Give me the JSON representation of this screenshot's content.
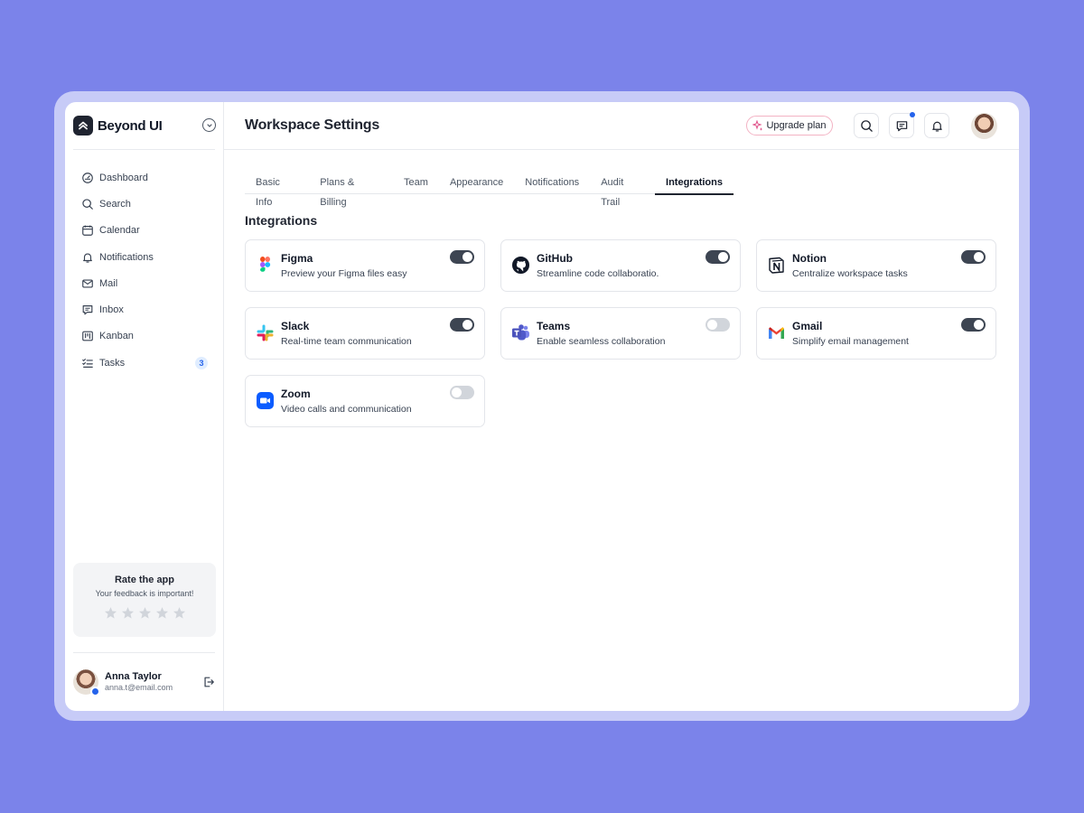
{
  "brand": {
    "name": "Beyond UI"
  },
  "sidebar": {
    "items": [
      {
        "label": "Dashboard",
        "icon": "dashboard-icon"
      },
      {
        "label": "Search",
        "icon": "search-icon"
      },
      {
        "label": "Calendar",
        "icon": "calendar-icon"
      },
      {
        "label": "Notifications",
        "icon": "bell-icon"
      },
      {
        "label": "Mail",
        "icon": "mail-icon"
      },
      {
        "label": "Inbox",
        "icon": "inbox-icon"
      },
      {
        "label": "Kanban",
        "icon": "kanban-icon"
      },
      {
        "label": "Tasks",
        "icon": "tasks-icon",
        "badge": "3"
      }
    ],
    "rate": {
      "title": "Rate the app",
      "subtitle": "Your feedback is important!",
      "stars_filled": 0,
      "stars_total": 5
    },
    "user": {
      "name": "Anna Taylor",
      "email": "anna.t@email.com"
    }
  },
  "header": {
    "title": "Workspace Settings",
    "upgrade_label": "Upgrade plan",
    "has_unread_messages": true
  },
  "tabs": [
    {
      "label": "Basic Info",
      "active": false
    },
    {
      "label": "Plans & Billing",
      "active": false
    },
    {
      "label": "Team",
      "active": false
    },
    {
      "label": "Appearance",
      "active": false
    },
    {
      "label": "Notifications",
      "active": false
    },
    {
      "label": "Audit Trail",
      "active": false
    },
    {
      "label": "Integrations",
      "active": true
    }
  ],
  "integrations": {
    "title": "Integrations",
    "items": [
      {
        "name": "Figma",
        "description": "Preview your Figma files easy",
        "enabled": true,
        "icon": "figma-icon"
      },
      {
        "name": "GitHub",
        "description": "Streamline code collaboratio.",
        "enabled": true,
        "icon": "github-icon"
      },
      {
        "name": "Notion",
        "description": "Centralize workspace tasks",
        "enabled": true,
        "icon": "notion-icon"
      },
      {
        "name": "Slack",
        "description": "Real-time team communication",
        "enabled": true,
        "icon": "slack-icon"
      },
      {
        "name": "Teams",
        "description": "Enable seamless collaboration",
        "enabled": false,
        "icon": "teams-icon"
      },
      {
        "name": "Gmail",
        "description": "Simplify email management",
        "enabled": true,
        "icon": "gmail-icon"
      },
      {
        "name": "Zoom",
        "description": "Video calls and communication",
        "enabled": false,
        "icon": "zoom-icon"
      }
    ]
  },
  "colors": {
    "background": "#7b83ea",
    "accent": "#2563eb",
    "toggle_on": "#3d4552",
    "toggle_off": "#d1d5db"
  }
}
